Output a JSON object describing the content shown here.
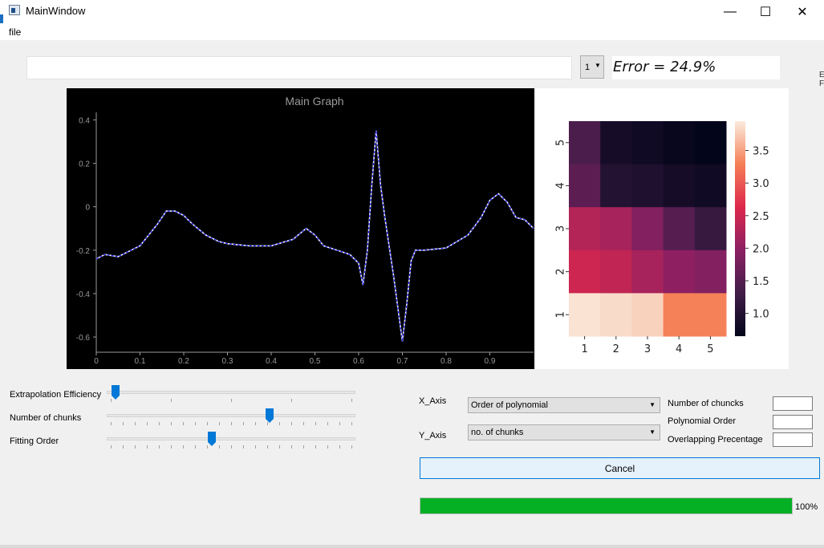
{
  "window": {
    "title": "MainWindow",
    "minimize": "—",
    "maximize": "☐",
    "close": "✕"
  },
  "menu": {
    "file": "file"
  },
  "toolbar": {
    "input_value": "",
    "combo_value": "1",
    "combo_arrow": "▼",
    "error_text": "Error = 24.9%"
  },
  "chart_data": [
    {
      "type": "line",
      "title": "Main Graph",
      "xlabel": "",
      "ylabel": "",
      "xlim": [
        0,
        1.0
      ],
      "ylim": [
        -0.67,
        0.42
      ],
      "xticks": [
        0,
        0.1,
        0.2,
        0.3,
        0.4,
        0.5,
        0.6,
        0.7,
        0.8,
        0.9
      ],
      "xtick_labels": [
        "0",
        "0.1",
        "0.2",
        "0.3",
        "0.4",
        "0.5",
        "0.6",
        "0.7",
        "0.8",
        "0.9"
      ],
      "yticks": [
        0.4,
        0.2,
        0,
        -0.2,
        -0.4,
        -0.6
      ],
      "ytick_labels": [
        "0.4",
        "0.2",
        "0",
        "-0.2",
        "-0.4",
        "-0.6"
      ],
      "background": "#000000",
      "series": [
        {
          "color": "#ffffff",
          "x": [
            0,
            0.02,
            0.05,
            0.08,
            0.1,
            0.12,
            0.14,
            0.16,
            0.18,
            0.2,
            0.22,
            0.25,
            0.28,
            0.3,
            0.35,
            0.4,
            0.45,
            0.48,
            0.5,
            0.52,
            0.55,
            0.58,
            0.6,
            0.61,
            0.62,
            0.63,
            0.64,
            0.65,
            0.66,
            0.68,
            0.7,
            0.71,
            0.72,
            0.73,
            0.75,
            0.8,
            0.85,
            0.88,
            0.9,
            0.92,
            0.94,
            0.96,
            0.98,
            1.0
          ],
          "y": [
            -0.24,
            -0.22,
            -0.23,
            -0.2,
            -0.18,
            -0.13,
            -0.08,
            -0.02,
            -0.02,
            -0.04,
            -0.08,
            -0.13,
            -0.16,
            -0.17,
            -0.18,
            -0.18,
            -0.15,
            -0.1,
            -0.13,
            -0.18,
            -0.2,
            -0.22,
            -0.26,
            -0.36,
            -0.2,
            0.1,
            0.35,
            0.1,
            -0.05,
            -0.32,
            -0.62,
            -0.45,
            -0.25,
            -0.2,
            -0.2,
            -0.19,
            -0.13,
            -0.05,
            0.03,
            0.06,
            0.02,
            -0.05,
            -0.06,
            -0.1
          ]
        },
        {
          "color": "#1010ff",
          "x": [
            0,
            0.02,
            0.05,
            0.08,
            0.1,
            0.12,
            0.14,
            0.16,
            0.18,
            0.2,
            0.22,
            0.25,
            0.28,
            0.3,
            0.35,
            0.4,
            0.45,
            0.48,
            0.5,
            0.52,
            0.55,
            0.58,
            0.6,
            0.61,
            0.62,
            0.63,
            0.64,
            0.65,
            0.66,
            0.68,
            0.7,
            0.71,
            0.72,
            0.73,
            0.75,
            0.8,
            0.85,
            0.88,
            0.9,
            0.92,
            0.94,
            0.96,
            0.98,
            1.0
          ],
          "y": [
            -0.24,
            -0.22,
            -0.23,
            -0.2,
            -0.18,
            -0.13,
            -0.08,
            -0.02,
            -0.02,
            -0.04,
            -0.08,
            -0.13,
            -0.16,
            -0.17,
            -0.18,
            -0.18,
            -0.15,
            -0.1,
            -0.13,
            -0.18,
            -0.2,
            -0.22,
            -0.26,
            -0.36,
            -0.2,
            0.1,
            0.35,
            0.1,
            -0.05,
            -0.32,
            -0.62,
            -0.45,
            -0.25,
            -0.2,
            -0.2,
            -0.19,
            -0.13,
            -0.05,
            0.03,
            0.06,
            0.02,
            -0.05,
            -0.06,
            -0.1
          ]
        }
      ]
    },
    {
      "type": "heatmap",
      "x_labels": [
        "1",
        "2",
        "3",
        "4",
        "5"
      ],
      "y_labels": [
        "1",
        "2",
        "3",
        "4",
        "5"
      ],
      "values_by_row": {
        "5": [
          1.4,
          0.85,
          0.8,
          0.7,
          0.65
        ],
        "4": [
          1.55,
          1.0,
          0.95,
          0.85,
          0.8
        ],
        "3": [
          2.3,
          2.2,
          1.9,
          1.5,
          1.2
        ],
        "2": [
          2.5,
          2.4,
          2.2,
          2.0,
          1.9
        ],
        "1": [
          3.9,
          3.85,
          3.8,
          3.3,
          3.3
        ]
      },
      "colorbar_ticks": [
        "3.5",
        "3.0",
        "2.5",
        "2.0",
        "1.5",
        "1.0"
      ],
      "colorbar_values": [
        3.5,
        3.0,
        2.5,
        2.0,
        1.5,
        1.0
      ],
      "vmin": 0.65,
      "vmax": 3.95,
      "colormap": "rocket"
    }
  ],
  "sliders": [
    {
      "label": "Extrapolation Efficiency",
      "value": 0.02,
      "ticks": 5
    },
    {
      "label": "Number of chunks",
      "value": 0.66,
      "ticks": 21
    },
    {
      "label": "Fitting Order",
      "value": 0.42,
      "ticks": 21
    }
  ],
  "axes_controls": {
    "x_label": "X_Axis",
    "x_value": "Order of polynomial",
    "y_label": "Y_Axis",
    "y_value": "no. of chunks",
    "arrow": "▼"
  },
  "params": [
    {
      "label": "Number of chuncks",
      "value": ""
    },
    {
      "label": "Polynomial Order",
      "value": ""
    },
    {
      "label": "Overlapping Precentage",
      "value": ""
    }
  ],
  "cancel_label": "Cancel",
  "progress": {
    "value": 1.0,
    "text": "100%",
    "color": "#06b025"
  },
  "edge_text": {
    "a": "E",
    "b": "F"
  }
}
